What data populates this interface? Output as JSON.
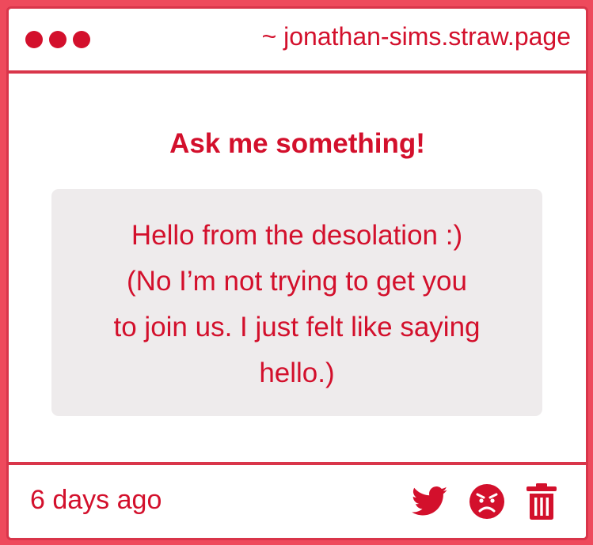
{
  "window": {
    "url": "~ jonathan-sims.straw.page",
    "dots_icon": "window-dots"
  },
  "card": {
    "prompt": "Ask me something!",
    "question_lines": [
      "Hello from the desolation :)",
      "(No I’m not trying to get you",
      "to join us. I just felt like saying",
      "hello.)"
    ]
  },
  "footer": {
    "time": "6 days ago",
    "icons": [
      "twitter-icon",
      "angry-face-icon",
      "trash-icon"
    ]
  },
  "colors": {
    "accent": "#d3102c",
    "border": "#d9354a",
    "background": "#ee4a5c",
    "question_bg": "#eeebec"
  }
}
